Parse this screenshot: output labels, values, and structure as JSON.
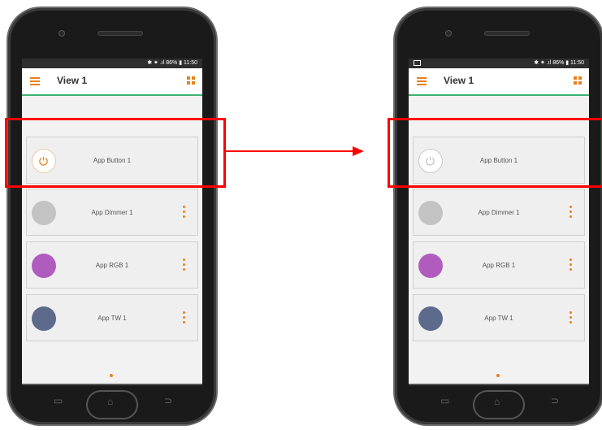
{
  "status": {
    "text": "✱ ⁕ .ıl 86% ▮ 11:50"
  },
  "appbar": {
    "title": "View 1"
  },
  "cards": [
    {
      "label": "App Button 1",
      "color": "#ffffff"
    },
    {
      "label": "App Dimmer 1",
      "color": "#c3c3c3"
    },
    {
      "label": "App RGB 1",
      "color": "#b05cbf"
    },
    {
      "label": "App TW 1",
      "color": "#5d6a8c"
    }
  ],
  "colors": {
    "accent": "#e8801b",
    "highlight": "#ff0000",
    "appbar_line": "#3cb371"
  },
  "icons": [
    "menu-icon",
    "grid-icon",
    "power-icon",
    "more-vertical-icon",
    "recent-apps-icon",
    "home-icon",
    "back-icon"
  ],
  "states": {
    "left_button_icon": "on",
    "right_button_icon": "off"
  }
}
